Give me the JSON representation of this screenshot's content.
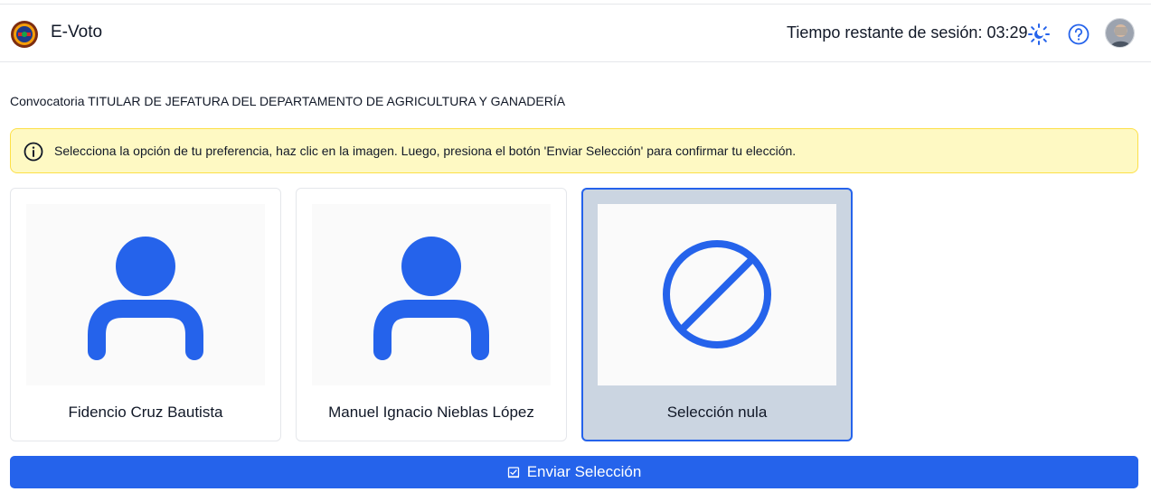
{
  "header": {
    "app_title": "E-Voto",
    "session_label": "Tiempo restante de sesión: 03:29",
    "icons": [
      "seal-logo",
      "sun-moon-icon",
      "help-icon",
      "user-avatar"
    ]
  },
  "convocatoria": "Convocatoria TITULAR DE JEFATURA DEL DEPARTAMENTO DE AGRICULTURA Y GANADERÍA",
  "alert": {
    "icon": "info-icon",
    "text": "Selecciona la opción de tu preferencia, haz clic en la imagen. Luego, presiona el botón 'Enviar Selección' para confirmar tu elección."
  },
  "options": [
    {
      "name": "Fidencio Cruz Bautista",
      "icon": "person-icon",
      "selected": false
    },
    {
      "name": "Manuel Ignacio Nieblas López",
      "icon": "person-icon",
      "selected": false
    },
    {
      "name": "Selección nula",
      "icon": "ban-icon",
      "selected": true
    }
  ],
  "submit": {
    "label": "Enviar Selección",
    "icon": "ballot-check-icon"
  },
  "colors": {
    "primary": "#2563eb",
    "alert_bg": "#fef9c3",
    "alert_border": "#fde047",
    "selected_bg": "#cbd5e1"
  }
}
